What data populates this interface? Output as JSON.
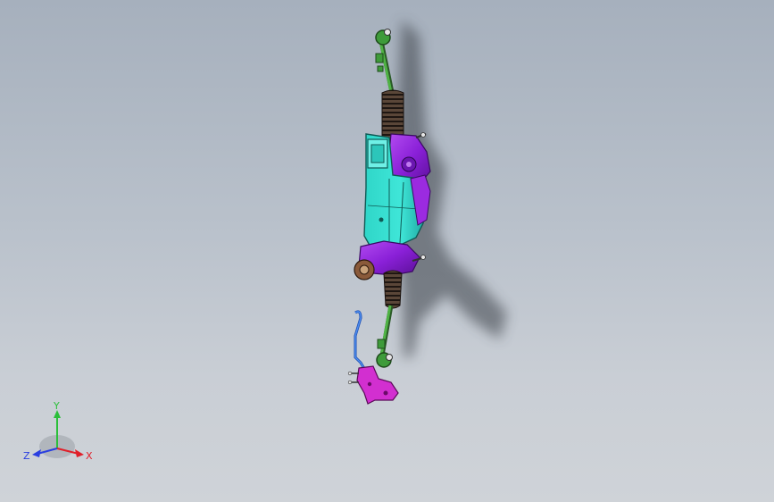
{
  "viewport": {
    "background_top": "#a6b0bd",
    "background_bottom": "#cfd3d8"
  },
  "model": {
    "parts": [
      {
        "name": "steering-rack-housing",
        "color": "#35e0d0"
      },
      {
        "name": "gear-housing",
        "color": "#9b2be0"
      },
      {
        "name": "bellows-boot",
        "color": "#3a2a22"
      },
      {
        "name": "tie-rod",
        "color": "#3e9b3a"
      },
      {
        "name": "mounting-bracket",
        "color": "#d22fd0"
      },
      {
        "name": "hydraulic-line",
        "color": "#2a6fe0"
      }
    ]
  },
  "triad": {
    "x_label": "X",
    "y_label": "Y",
    "z_label": "Z",
    "x_color": "#e0202a",
    "y_color": "#2bbf3a",
    "z_color": "#2a3fe0"
  }
}
